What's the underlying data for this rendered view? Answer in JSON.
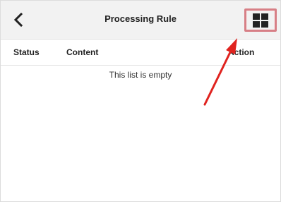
{
  "header": {
    "title": "Processing Rule",
    "back_icon": "chevron-left-icon",
    "layout_icon": "grid-icon"
  },
  "table": {
    "columns": [
      "Status",
      "Content",
      "Action"
    ],
    "empty_text": "This list is empty"
  },
  "annotation": {
    "highlight_color": "#d77f86",
    "arrow_color": "#e0231f"
  }
}
